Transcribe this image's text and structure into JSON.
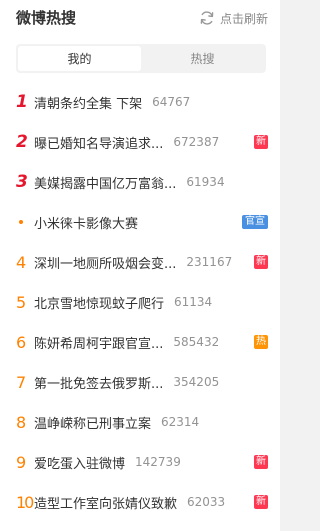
{
  "header": {
    "title": "微博热搜",
    "refresh_label": "点击刷新"
  },
  "tabs": [
    {
      "label": "我的",
      "active": true
    },
    {
      "label": "热搜",
      "active": false
    }
  ],
  "items": [
    {
      "rank": "1",
      "label": "清朝条约全集 下架",
      "count": "64767",
      "badge": ""
    },
    {
      "rank": "2",
      "label": "曝已婚知名导演追求...",
      "count": "672387",
      "badge": "新"
    },
    {
      "rank": "3",
      "label": "美媒揭露中国亿万富翁...",
      "count": "61934",
      "badge": ""
    },
    {
      "rank": "",
      "label": "小米徕卡影像大赛",
      "count": "",
      "badge": "官宣"
    },
    {
      "rank": "4",
      "label": "深圳一地厕所吸烟会变...",
      "count": "231167",
      "badge": "新"
    },
    {
      "rank": "5",
      "label": "北京雪地惊现蚊子爬行",
      "count": "61134",
      "badge": ""
    },
    {
      "rank": "6",
      "label": "陈妍希周柯宇跟官宣...",
      "count": "585432",
      "badge": "热"
    },
    {
      "rank": "7",
      "label": "第一批免签去俄罗斯...",
      "count": "354205",
      "badge": ""
    },
    {
      "rank": "8",
      "label": "温峥嵘称已刑事立案",
      "count": "62314",
      "badge": ""
    },
    {
      "rank": "9",
      "label": "爱吃蛋入驻微博",
      "count": "142739",
      "badge": "新"
    },
    {
      "rank": "10",
      "label": "造型工作室向张婧仪致歉",
      "count": "62033",
      "badge": "新"
    }
  ],
  "colors": {
    "rank_top": "#e6162d",
    "rank_rest": "#ff8200",
    "badge_new": "#ff3852",
    "badge_hot": "#ff9406",
    "badge_ad": "#4a90e2"
  }
}
